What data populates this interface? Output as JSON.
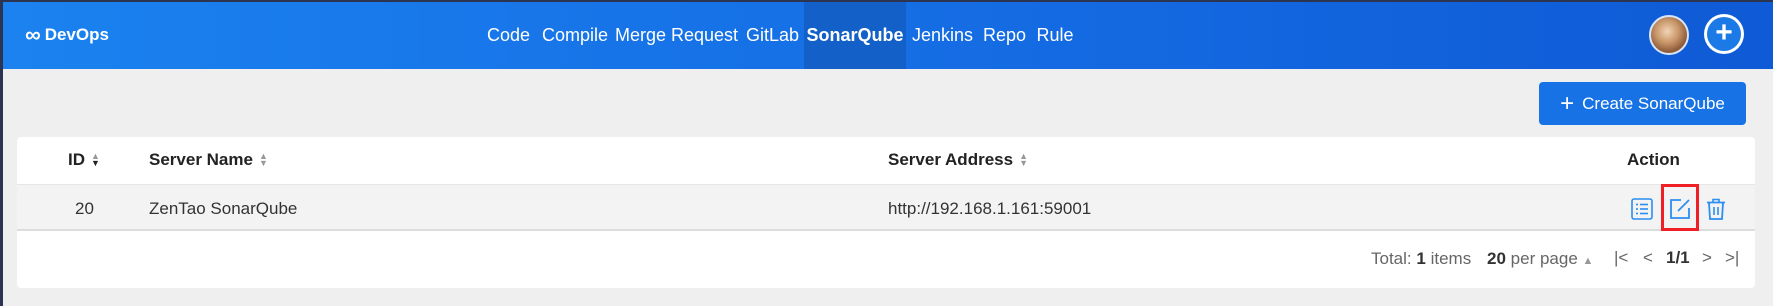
{
  "brand": {
    "name": "DevOps",
    "symbol": "∞"
  },
  "nav": {
    "items": [
      "Code",
      "Compile",
      "Merge Request",
      "GitLab",
      "SonarQube",
      "Jenkins",
      "Repo",
      "Rule"
    ],
    "active": "SonarQube"
  },
  "toolbar": {
    "create_label": "Create SonarQube",
    "create_symbol": "+"
  },
  "add_symbol": "+",
  "table": {
    "columns": [
      "ID",
      "Server Name",
      "Server Address",
      "Action"
    ],
    "rows": [
      {
        "id": "20",
        "server_name": "ZenTao SonarQube",
        "server_address": "http://192.168.1.161:59001"
      }
    ]
  },
  "pagination": {
    "total_label": "Total:",
    "total_count": "1",
    "items_label": "items",
    "per_page_count": "20",
    "per_page_label": "per page",
    "page": "1/1"
  },
  "colors": {
    "accent": "#1672e5",
    "highlight": "#ee1f25",
    "icon": "#2b8ef0"
  }
}
